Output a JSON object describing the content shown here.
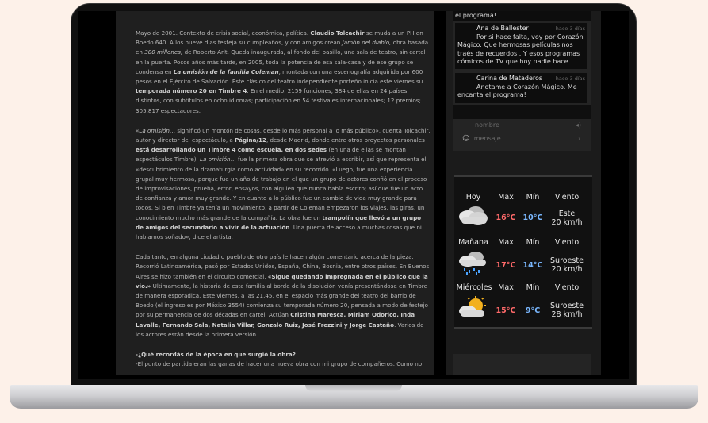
{
  "article": {
    "p1": [
      {
        "t": "Mayo de 2001. Contexto de crisis social, económica, política. "
      },
      {
        "t": "Claudio Tolcachir",
        "s": "b"
      },
      {
        "t": " se muda a un PH en Boedo 640. A los nueve días festeja su cumpleaños, y con amigos crean "
      },
      {
        "t": "Jamón del diablo,",
        "s": "i"
      },
      {
        "t": " obra basada en "
      },
      {
        "t": "300 millones,",
        "s": "i"
      },
      {
        "t": " de Roberto Arlt. Queda inaugurada, al fondo del pasillo, una sala de teatro, sin cartel en la puerta. Pocos años más tarde, en 2005, toda la potencia de esa sala-casa y de ese grupo se condensa en "
      },
      {
        "t": "La omisión de la familia Coleman",
        "s": "bi"
      },
      {
        "t": ", montada con una escenografía adquirida por 600 pesos en el Ejército de Salvación. Este clásico del teatro independiente porteño inicia este viernes su "
      },
      {
        "t": "temporada número 20 en Timbre 4",
        "s": "b"
      },
      {
        "t": ". En el medio: 2159 funciones, 384 de ellas en 24 países distintos, con subtítulos en ocho idiomas; participación en 54 festivales internacionales; 12 premios; 305.817 espectadores."
      }
    ],
    "p2": [
      {
        "t": "«"
      },
      {
        "t": "La omisión",
        "s": "i"
      },
      {
        "t": "… significó un montón de cosas, desde lo más personal a lo más público», cuenta Tolcachir, autor y director del espectáculo, a "
      },
      {
        "t": "Página/12",
        "s": "b"
      },
      {
        "t": ", desde Madrid, donde entre otros proyectos personales "
      },
      {
        "t": "está desarrollando un Timbre 4 como escuela, en dos sedes",
        "s": "b"
      },
      {
        "t": " (en una de ellas se montan espectáculos Timbre). "
      },
      {
        "t": "La omisión",
        "s": "i"
      },
      {
        "t": "… fue la primera obra que se atrevió a escribir, así que representa el «descubrimiento de la dramaturgia como actividad» en su recorrido. «Luego, fue una experiencia grupal muy hermosa, porque fue un año de trabajo en el que un grupo de actores confió en el proceso de improvisaciones, prueba, error, ensayos, con alguien que nunca había escrito; así que fue un acto de confianza y amor muy grande. Y en cuanto a lo público fue un cambio de vida muy grande para todos. Si bien Timbre ya tenía un movimiento, a partir de Coleman empezaron los viajes, las giras, un conocimiento mucho más grande de la compañía. La obra fue un "
      },
      {
        "t": "trampolín que llevó a un grupo de amigos del secundario a vivir de la actuación",
        "s": "b"
      },
      {
        "t": ". Una puerta de acceso a muchas cosas que ni hablamos soñado», dice el artista."
      }
    ],
    "p3": [
      {
        "t": "Cada tanto, en alguna ciudad o pueblo de otro país le hacen algún comentario acerca de la pieza. Recorrió Latinoamérica, pasó por Estados Unidos, España, China, Bosnia, entre otros países. En Buenos Aires se hizo también en el circuito comercial. "
      },
      {
        "t": "«Sigue quedando impregnada en el público que la vio.»",
        "s": "b"
      },
      {
        "t": " Ultimamente, la historia de esta familia al borde de la disolución venía presentándose en Timbre de manera esporádica. Este viernes, a las 21.45, en el espacio más grande del teatro del barrio de Boedo (el ingreso es por México 3554) comienza su temporada número 20, pensada a modo de festejo por su permanencia de dos décadas en cartel. Actúan "
      },
      {
        "t": "Cristina Maresca, Miriam Odorico, Inda Lavalle, Fernando Sala, Natalia Villar, Gonzalo Ruiz, José Frezzini y Jorge Castaño",
        "s": "b"
      },
      {
        "t": ". Varios de los actores están desde la primera versión."
      }
    ],
    "p4": [
      {
        "t": "-¿Qué recordás de la época en que surgió la obra?",
        "s": "b"
      },
      {
        "t": "\n-El punto de partida eran las ganas de hacer una nueva obra con mi grupo de compañeros. Como no"
      }
    ]
  },
  "chat": {
    "top_line": "el programa!",
    "messages": [
      {
        "name": "Ana de Ballester",
        "time": "hace 3 días",
        "text": "Por si hace falta, voy por Corazón Mágico. Que hermosas películas nos traés de recuerdos . Y esos programas cómicos de TV que hoy nadie hace."
      },
      {
        "name": "Carina de Mataderos",
        "time": "hace 3 días",
        "text": "Anotame a Corazón Mágico. Me encanta el programa!"
      }
    ],
    "name_placeholder": "nombre",
    "message_placeholder": "mensaje"
  },
  "weather": {
    "header": {
      "max": "Max",
      "min": "Mín",
      "wind": "Viento"
    },
    "days": [
      {
        "day": "Hoy",
        "max": "16°C",
        "min": "10°C",
        "wind_dir": "Este",
        "wind_speed": "20 km/h",
        "icon": "cloudy-icon"
      },
      {
        "day": "Mañana",
        "max": "17°C",
        "min": "14°C",
        "wind_dir": "Suroeste",
        "wind_speed": "20 km/h",
        "icon": "rain-icon"
      },
      {
        "day": "Miércoles",
        "max": "15°C",
        "min": "9°C",
        "wind_dir": "Suroeste",
        "wind_speed": "28 km/h",
        "icon": "partly-cloudy-icon"
      }
    ]
  }
}
